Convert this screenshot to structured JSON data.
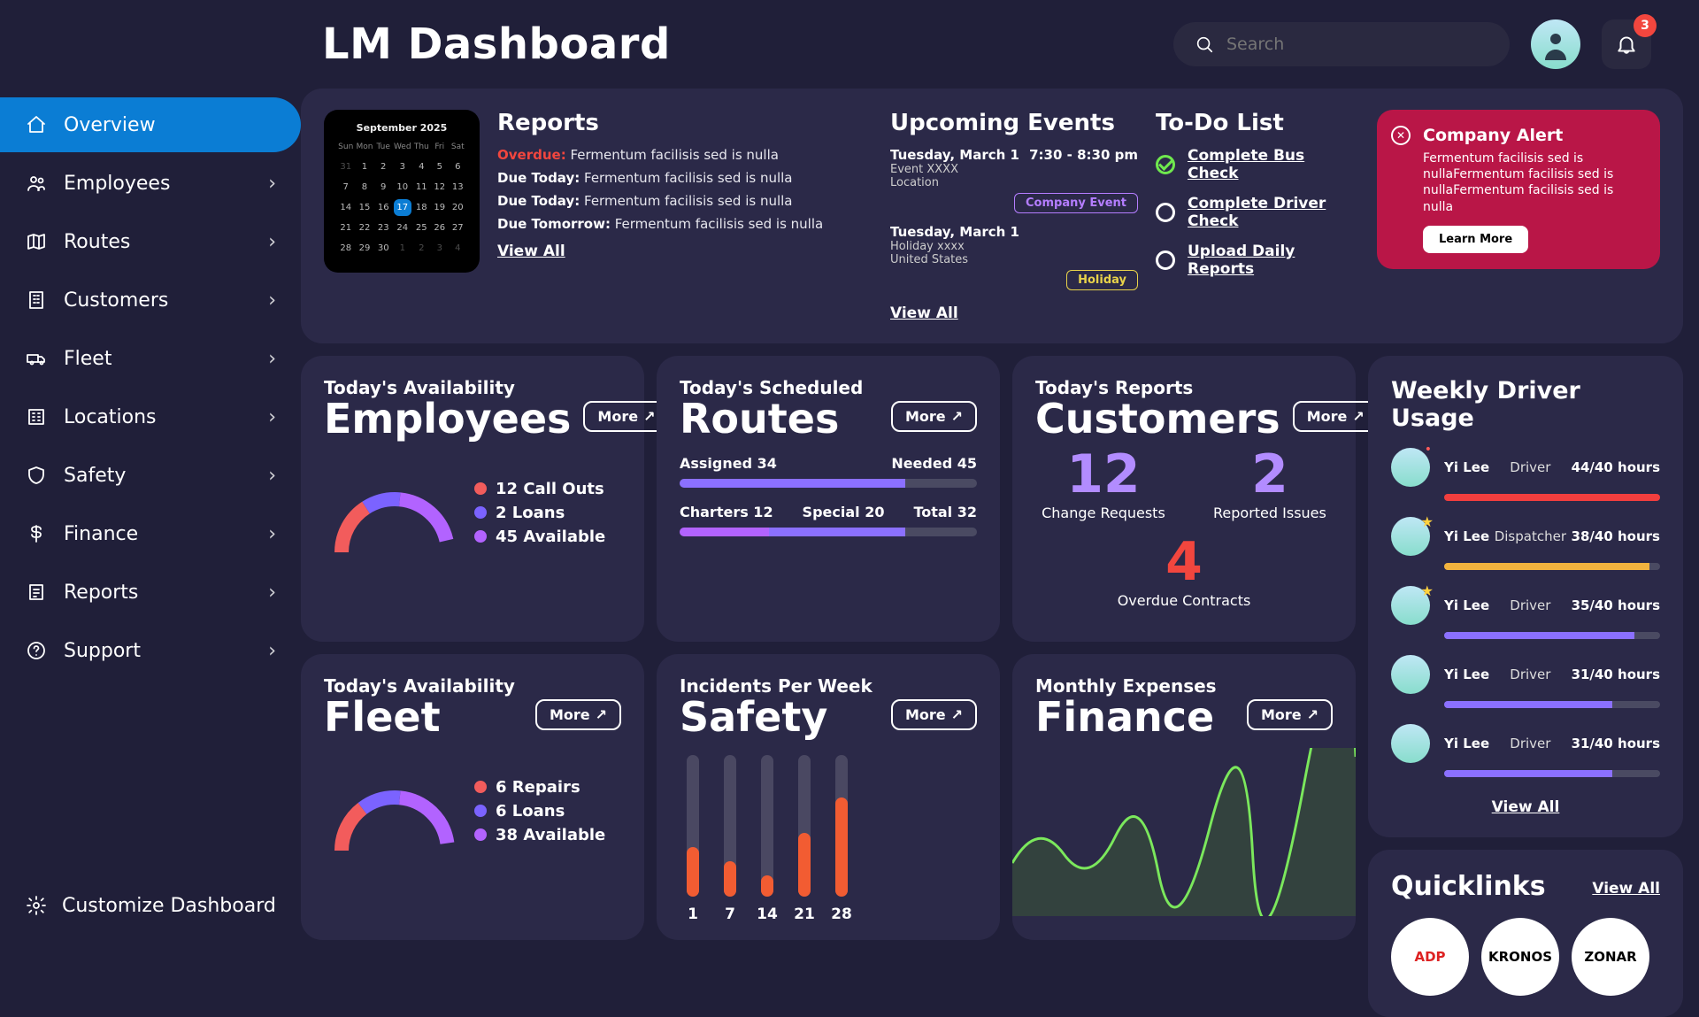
{
  "header": {
    "title": "LM Dashboard",
    "search_placeholder": "Search",
    "bell_badge": "3"
  },
  "sidebar": {
    "items": [
      {
        "label": "Overview",
        "icon": "home"
      },
      {
        "label": "Employees",
        "icon": "people"
      },
      {
        "label": "Routes",
        "icon": "map"
      },
      {
        "label": "Customers",
        "icon": "building"
      },
      {
        "label": "Fleet",
        "icon": "truck"
      },
      {
        "label": "Locations",
        "icon": "building2"
      },
      {
        "label": "Safety",
        "icon": "shield"
      },
      {
        "label": "Finance",
        "icon": "dollar"
      },
      {
        "label": "Reports",
        "icon": "reports"
      },
      {
        "label": "Support",
        "icon": "help"
      }
    ],
    "customize": "Customize Dashboard"
  },
  "summary": {
    "calendar": {
      "month": "September 2025",
      "today": 17
    },
    "reports": {
      "title": "Reports",
      "items": [
        {
          "tag": "Overdue:",
          "text": "Fermentum facilisis sed is nulla",
          "overdue": true
        },
        {
          "tag": "Due Today:",
          "text": "Fermentum facilisis sed is nulla"
        },
        {
          "tag": "Due Today:",
          "text": "Fermentum facilisis sed is nulla"
        },
        {
          "tag": "Due Tomorrow:",
          "text": "Fermentum facilisis sed is nulla"
        }
      ],
      "view_all": "View All"
    },
    "events": {
      "title": "Upcoming Events",
      "items": [
        {
          "date": "Tuesday, March 1",
          "time": "7:30 - 8:30 pm",
          "line1": "Event XXXX",
          "line2": "Location",
          "tag": "Company Event",
          "tagClass": "ce"
        },
        {
          "date": "Tuesday, March 1",
          "time": "",
          "line1": "Holiday xxxx",
          "line2": "United States",
          "tag": "Holiday",
          "tagClass": "ho"
        }
      ],
      "view_all": "View All"
    },
    "todo": {
      "title": "To-Do List",
      "items": [
        {
          "label": "Complete Bus Check",
          "done": true
        },
        {
          "label": "Complete Driver Check",
          "done": false
        },
        {
          "label": "Upload Daily Reports",
          "done": false
        }
      ]
    },
    "alert": {
      "title": "Company Alert",
      "body": "Fermentum facilisis sed is nullaFermentum facilisis sed is nullaFermentum facilisis sed is nulla",
      "cta": "Learn More"
    }
  },
  "employees": {
    "sub": "Today's Availability",
    "title": "Employees",
    "more": "More",
    "items": [
      {
        "n": "12",
        "t": "Call Outs",
        "c": "#f25c5c"
      },
      {
        "n": "2",
        "t": "Loans",
        "c": "#7b63ff"
      },
      {
        "n": "45",
        "t": "Available",
        "c": "#b263ff"
      }
    ]
  },
  "routes": {
    "sub": "Today's Scheduled",
    "title": "Routes",
    "more": "More",
    "assigned": "Assigned 34",
    "needed": "Needed 45",
    "assigned_pct": 76,
    "charters": "Charters 12",
    "special": "Special 20",
    "total": "Total 32",
    "ch_pct": 38,
    "sp_pct": 50
  },
  "customers": {
    "sub": "Today's Reports",
    "title": "Customers",
    "more": "More",
    "n1": "12",
    "l1": "Change Requests",
    "n2": "2",
    "l2": "Reported Issues",
    "n3": "4",
    "l3": "Overdue Contracts"
  },
  "fleet": {
    "sub": "Today's Availability",
    "title": "Fleet",
    "more": "More",
    "items": [
      {
        "n": "6",
        "t": "Repairs",
        "c": "#f25c5c"
      },
      {
        "n": "6",
        "t": "Loans",
        "c": "#7b63ff"
      },
      {
        "n": "38",
        "t": "Available",
        "c": "#b263ff"
      }
    ]
  },
  "safety": {
    "sub": "Incidents Per Week",
    "title": "Safety",
    "more": "More"
  },
  "finance": {
    "sub": "Monthly Expenses",
    "title": "Finance",
    "more": "More"
  },
  "drivers": {
    "title": "Weekly Driver Usage",
    "items": [
      {
        "name": "Yi Lee",
        "role": "Driver",
        "hours": "44/40 hours",
        "pct": 100,
        "color": "#f23e3e",
        "red": true
      },
      {
        "name": "Yi Lee",
        "role": "Dispatcher",
        "hours": "38/40 hours",
        "pct": 95,
        "color": "#f2b33e",
        "star": true
      },
      {
        "name": "Yi Lee",
        "role": "Driver",
        "hours": "35/40 hours",
        "pct": 88,
        "color": "#8b70ff",
        "star": true
      },
      {
        "name": "Yi Lee",
        "role": "Driver",
        "hours": "31/40 hours",
        "pct": 78,
        "color": "#8b70ff"
      },
      {
        "name": "Yi Lee",
        "role": "Driver",
        "hours": "31/40 hours",
        "pct": 78,
        "color": "#8b70ff"
      }
    ],
    "view_all": "View All"
  },
  "quicklinks": {
    "title": "Quicklinks",
    "view_all": "View All",
    "items": [
      "ADP",
      "KRONOS",
      "ZONAR"
    ]
  },
  "chart_data": [
    {
      "type": "bar",
      "title": "Incidents Per Week",
      "categories": [
        "1",
        "7",
        "14",
        "21",
        "28"
      ],
      "values": [
        35,
        25,
        15,
        45,
        70
      ],
      "ylim": [
        0,
        100
      ]
    },
    {
      "type": "line",
      "title": "Monthly Expenses",
      "x": [
        0,
        1,
        2,
        3,
        4,
        5,
        6,
        7,
        8,
        9,
        10,
        11
      ],
      "values": [
        40,
        55,
        35,
        50,
        30,
        42,
        25,
        52,
        55,
        40,
        75,
        90
      ]
    },
    {
      "type": "pie",
      "title": "Employees Availability",
      "slices": [
        {
          "name": "Call Outs",
          "value": 12,
          "color": "#f25c5c"
        },
        {
          "name": "Loans",
          "value": 2,
          "color": "#7b63ff"
        },
        {
          "name": "Available",
          "value": 45,
          "color": "#b263ff"
        }
      ]
    },
    {
      "type": "pie",
      "title": "Fleet Availability",
      "slices": [
        {
          "name": "Repairs",
          "value": 6,
          "color": "#f25c5c"
        },
        {
          "name": "Loans",
          "value": 6,
          "color": "#7b63ff"
        },
        {
          "name": "Available",
          "value": 38,
          "color": "#b263ff"
        }
      ]
    }
  ]
}
